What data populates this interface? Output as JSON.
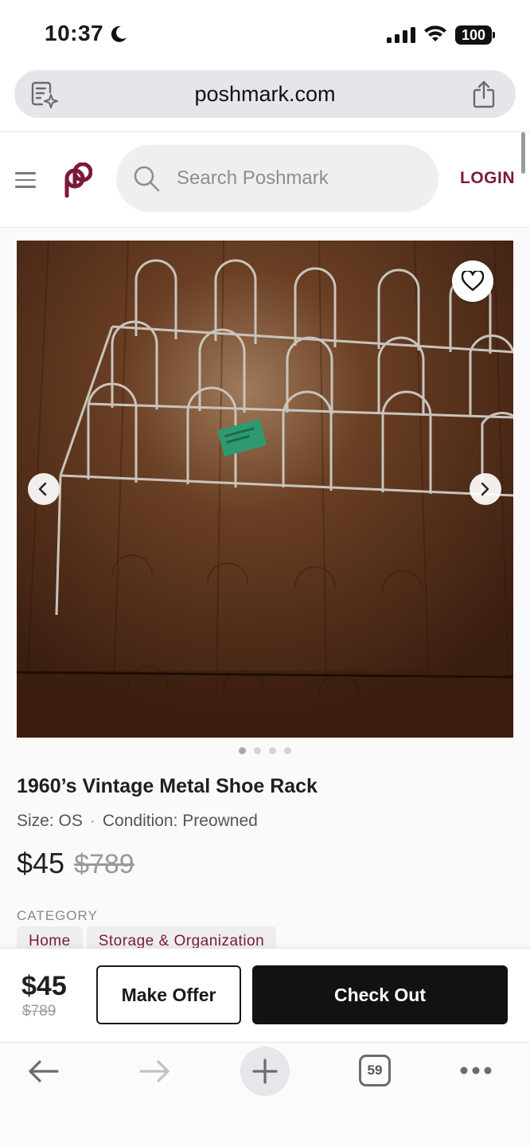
{
  "status_bar": {
    "time": "10:37",
    "battery": "100"
  },
  "browser": {
    "url": "poshmark.com",
    "tab_count": "59"
  },
  "header": {
    "search_placeholder": "Search Poshmark",
    "login_label": "LOGIN"
  },
  "listing": {
    "title": "1960’s Vintage Metal Shoe Rack",
    "size_label": "Size: OS",
    "condition_label": "Condition: Preowned",
    "price": "$45",
    "original_price": "$789",
    "category_heading": "CATEGORY",
    "categories": [
      "Home",
      "Storage & Organization"
    ],
    "photo_count": 4,
    "active_photo": 1
  },
  "actions": {
    "price": "$45",
    "original_price": "$789",
    "make_offer_label": "Make Offer",
    "checkout_label": "Check Out"
  },
  "colors": {
    "brand": "#7a1a3a",
    "checkout_bg": "#121212",
    "url_bar_bg": "#e4e6ea"
  }
}
